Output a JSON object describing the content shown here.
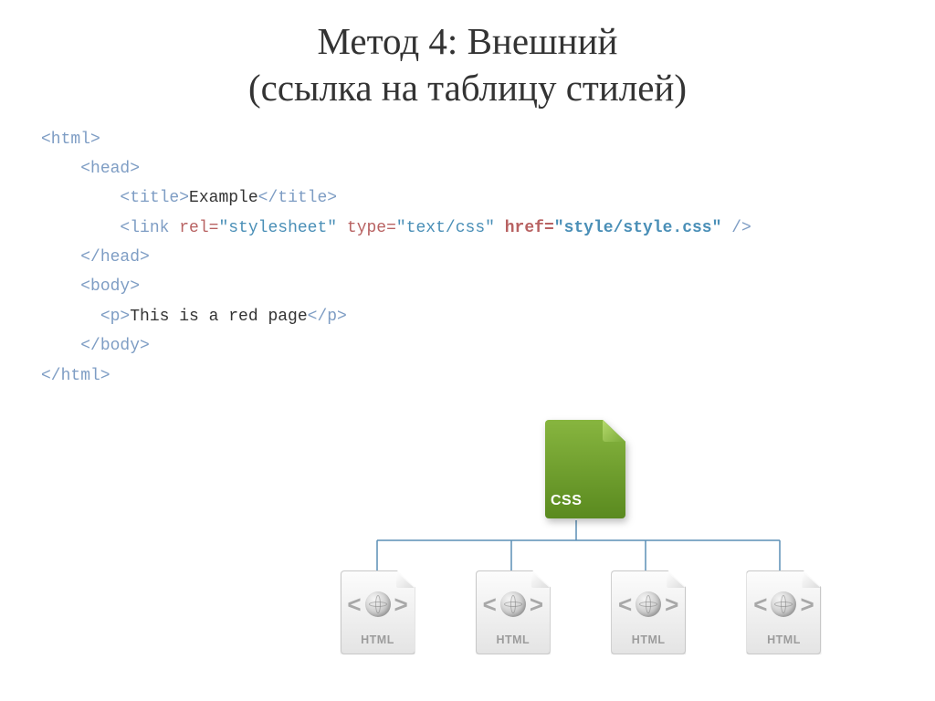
{
  "title_line1": "Метод 4: Внешний",
  "title_line2": "(ссылка на таблицу стилей)",
  "code": {
    "html_open": "<html>",
    "head_open": "<head>",
    "title_open": "<title>",
    "title_text": "Example",
    "title_close": "</title>",
    "link_open": "<link ",
    "rel_attr": "rel=",
    "rel_val": "\"stylesheet\"",
    "type_attr": "type=",
    "type_val": "\"text/css\"",
    "href_attr": "href=",
    "href_val": "\"style/style.css\"",
    "link_close": " />",
    "head_close": "</head>",
    "body_open": "<body>",
    "p_open": "<p>",
    "p_text": "This is a red page",
    "p_close": "</p>",
    "body_close": "</body>",
    "html_close": "</html>"
  },
  "css_label": "CSS",
  "html_label": "HTML"
}
